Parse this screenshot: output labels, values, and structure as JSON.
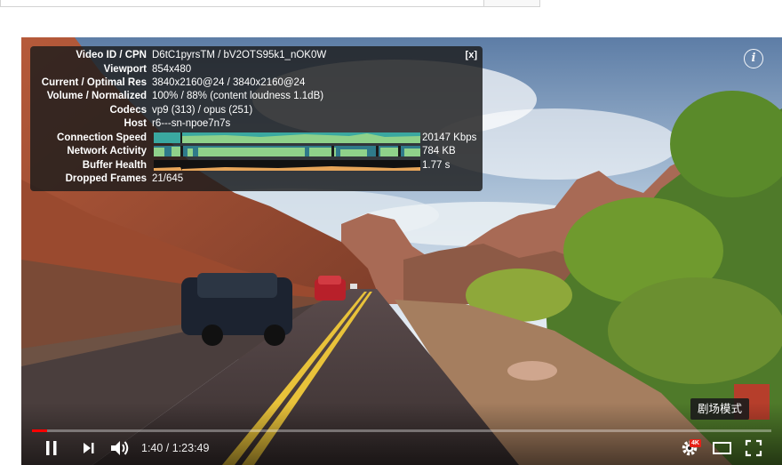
{
  "stats": {
    "close_label": "[x]",
    "rows": [
      {
        "key": "Video ID / CPN",
        "value": "D6tC1pyrsTM / bV2OTS95k1_nOK0W"
      },
      {
        "key": "Viewport",
        "value": "854x480"
      },
      {
        "key": "Current / Optimal Res",
        "value": "3840x2160@24 / 3840x2160@24"
      },
      {
        "key": "Volume / Normalized",
        "value": "100% / 88% (content loudness 1.1dB)"
      },
      {
        "key": "Codecs",
        "value": "vp9 (313) / opus (251)"
      },
      {
        "key": "Host",
        "value": "r6---sn-npoe7n7s"
      },
      {
        "key": "Connection Speed",
        "value": "20147 Kbps"
      },
      {
        "key": "Network Activity",
        "value": "784 KB"
      },
      {
        "key": "Buffer Health",
        "value": "1.77 s"
      },
      {
        "key": "Dropped Frames",
        "value": "21/645"
      }
    ]
  },
  "player": {
    "current_time": "1:40",
    "duration": "1:23:49",
    "time_display": "1:40 / 1:23:49",
    "progress_fraction": 0.0199,
    "quality_badge": "4K",
    "tooltip": "剧场模式",
    "info_label": "i"
  },
  "colors": {
    "progress": "#ff0000",
    "graph_teal": "#3aa8a0",
    "graph_green": "#8fd18a",
    "graph_orange": "#e8a65a"
  },
  "icons": [
    "info-icon",
    "pause-icon",
    "next-icon",
    "volume-icon",
    "settings-icon",
    "theater-mode-icon",
    "fullscreen-icon"
  ]
}
